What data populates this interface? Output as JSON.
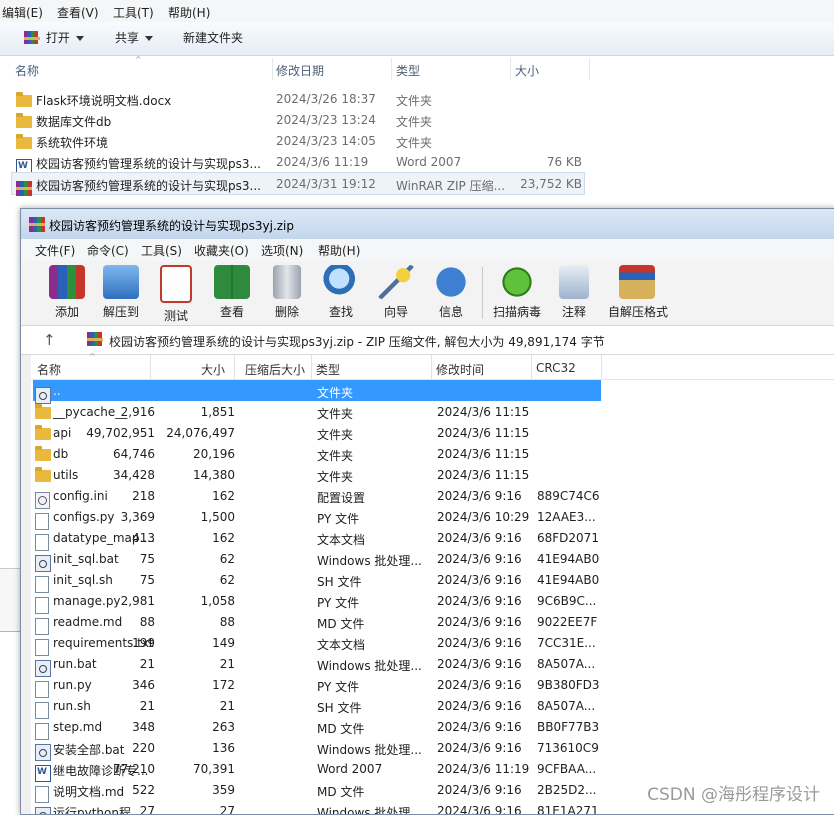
{
  "explorer": {
    "menu": [
      "编辑(E)",
      "查看(V)",
      "工具(T)",
      "帮助(H)"
    ],
    "toolbar": {
      "open_label": "打开",
      "share_label": "共享",
      "new_folder_label": "新建文件夹"
    },
    "columns": {
      "name": "名称",
      "date": "修改日期",
      "type": "类型",
      "size": "大小"
    },
    "rows": [
      {
        "icon": "folder",
        "name": "Flask环境说明文档.docx",
        "date": "2024/3/26 18:37",
        "type": "文件夹",
        "size": ""
      },
      {
        "icon": "folder",
        "name": "数据库文件db",
        "date": "2024/3/23 13:24",
        "type": "文件夹",
        "size": ""
      },
      {
        "icon": "folder",
        "name": "系统软件环境",
        "date": "2024/3/23 14:05",
        "type": "文件夹",
        "size": ""
      },
      {
        "icon": "word",
        "name": "校园访客预约管理系统的设计与实现ps3...",
        "date": "2024/3/6 11:19",
        "type": "Word 2007",
        "size": "76 KB"
      },
      {
        "icon": "rar",
        "name": "校园访客预约管理系统的设计与实现ps3...",
        "date": "2024/3/31 19:12",
        "type": "WinRAR ZIP 压缩...",
        "size": "23,752 KB"
      }
    ]
  },
  "winrar": {
    "title": "校园访客预约管理系统的设计与实现ps3yj.zip",
    "menu": [
      "文件(F)",
      "命令(C)",
      "工具(S)",
      "收藏夹(O)",
      "选项(N)",
      "帮助(H)"
    ],
    "tools": [
      {
        "label": "添加",
        "icon": "add-icon"
      },
      {
        "label": "解压到",
        "icon": "extract-icon"
      },
      {
        "label": "测试",
        "icon": "test-icon"
      },
      {
        "label": "查看",
        "icon": "view-icon"
      },
      {
        "label": "删除",
        "icon": "delete-icon"
      },
      {
        "label": "查找",
        "icon": "find-icon"
      },
      {
        "label": "向导",
        "icon": "wizard-icon"
      },
      {
        "label": "信息",
        "icon": "info-icon"
      },
      {
        "label": "扫描病毒",
        "icon": "virus-scan-icon"
      },
      {
        "label": "注释",
        "icon": "comment-icon"
      },
      {
        "label": "自解压格式",
        "icon": "sfx-icon"
      }
    ],
    "path_text": "校园访客预约管理系统的设计与实现ps3yj.zip - ZIP 压缩文件, 解包大小为 49,891,174 字节",
    "columns": {
      "name": "名称",
      "size": "大小",
      "packed": "压缩后大小",
      "type": "类型",
      "modified": "修改时间",
      "crc": "CRC32"
    },
    "rows": [
      {
        "icon": "up",
        "name": "..",
        "size": "",
        "packed": "",
        "type": "文件夹",
        "modified": "",
        "crc": ""
      },
      {
        "icon": "folder",
        "name": "__pycache__",
        "size": "2,916",
        "packed": "1,851",
        "type": "文件夹",
        "modified": "2024/3/6 11:15",
        "crc": ""
      },
      {
        "icon": "folder",
        "name": "api",
        "size": "49,702,951",
        "packed": "24,076,497",
        "type": "文件夹",
        "modified": "2024/3/6 11:15",
        "crc": ""
      },
      {
        "icon": "folder",
        "name": "db",
        "size": "64,746",
        "packed": "20,196",
        "type": "文件夹",
        "modified": "2024/3/6 11:15",
        "crc": ""
      },
      {
        "icon": "folder",
        "name": "utils",
        "size": "34,428",
        "packed": "14,380",
        "type": "文件夹",
        "modified": "2024/3/6 11:15",
        "crc": ""
      },
      {
        "icon": "cfg",
        "name": "config.ini",
        "size": "218",
        "packed": "162",
        "type": "配置设置",
        "modified": "2024/3/6 9:16",
        "crc": "889C74C6"
      },
      {
        "icon": "file",
        "name": "configs.py",
        "size": "3,369",
        "packed": "1,500",
        "type": "PY 文件",
        "modified": "2024/3/6 10:29",
        "crc": "12AAE3..."
      },
      {
        "icon": "file",
        "name": "datatype_map....",
        "size": "413",
        "packed": "162",
        "type": "文本文档",
        "modified": "2024/3/6 9:16",
        "crc": "68FD2071"
      },
      {
        "icon": "bat",
        "name": "init_sql.bat",
        "size": "75",
        "packed": "62",
        "type": "Windows 批处理...",
        "modified": "2024/3/6 9:16",
        "crc": "41E94AB0"
      },
      {
        "icon": "file",
        "name": "init_sql.sh",
        "size": "75",
        "packed": "62",
        "type": "SH 文件",
        "modified": "2024/3/6 9:16",
        "crc": "41E94AB0"
      },
      {
        "icon": "file",
        "name": "manage.py",
        "size": "2,981",
        "packed": "1,058",
        "type": "PY 文件",
        "modified": "2024/3/6 9:16",
        "crc": "9C6B9C..."
      },
      {
        "icon": "file",
        "name": "readme.md",
        "size": "88",
        "packed": "88",
        "type": "MD 文件",
        "modified": "2024/3/6 9:16",
        "crc": "9022EE7F"
      },
      {
        "icon": "file",
        "name": "requirements.txt",
        "size": "199",
        "packed": "149",
        "type": "文本文档",
        "modified": "2024/3/6 9:16",
        "crc": "7CC31E..."
      },
      {
        "icon": "bat",
        "name": "run.bat",
        "size": "21",
        "packed": "21",
        "type": "Windows 批处理...",
        "modified": "2024/3/6 9:16",
        "crc": "8A507A..."
      },
      {
        "icon": "file",
        "name": "run.py",
        "size": "346",
        "packed": "172",
        "type": "PY 文件",
        "modified": "2024/3/6 9:16",
        "crc": "9B380FD3"
      },
      {
        "icon": "file",
        "name": "run.sh",
        "size": "21",
        "packed": "21",
        "type": "SH 文件",
        "modified": "2024/3/6 9:16",
        "crc": "8A507A..."
      },
      {
        "icon": "file",
        "name": "step.md",
        "size": "348",
        "packed": "263",
        "type": "MD 文件",
        "modified": "2024/3/6 9:16",
        "crc": "BB0F77B3"
      },
      {
        "icon": "bat",
        "name": "安装全部.bat",
        "size": "220",
        "packed": "136",
        "type": "Windows 批处理...",
        "modified": "2024/3/6 9:16",
        "crc": "713610C9"
      },
      {
        "icon": "word",
        "name": "继电故障诊断专...",
        "size": "77,210",
        "packed": "70,391",
        "type": "Word 2007",
        "modified": "2024/3/6 11:19",
        "crc": "9CFBAA..."
      },
      {
        "icon": "file",
        "name": "说明文档.md",
        "size": "522",
        "packed": "359",
        "type": "MD 文件",
        "modified": "2024/3/6 9:16",
        "crc": "2B25D2..."
      },
      {
        "icon": "bat",
        "name": "运行python程...",
        "size": "27",
        "packed": "27",
        "type": "Windows 批处理...",
        "modified": "2024/3/6 9:16",
        "crc": "81E1A271"
      }
    ]
  },
  "watermark": "CSDN @海彤程序设计"
}
